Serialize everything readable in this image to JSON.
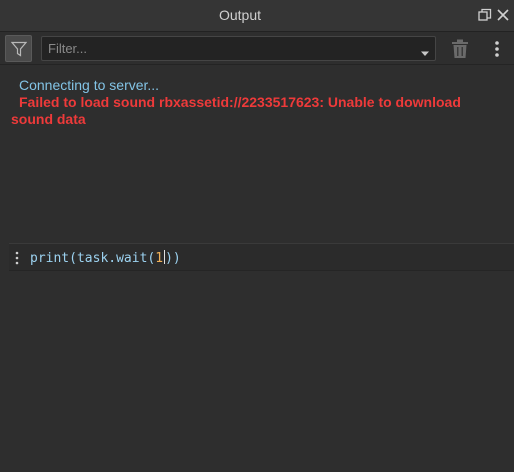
{
  "window": {
    "title": "Output",
    "restore_icon": "restore-window-icon",
    "close_icon": "close-icon"
  },
  "filter": {
    "toggle_icon": "filter-funnel-icon",
    "placeholder": "Filter...",
    "value": "",
    "dropdown_icon": "chevron-down-icon",
    "clear_icon": "trash-icon",
    "menu_icon": "more-vertical-icon"
  },
  "log": {
    "lines": [
      {
        "type": "info",
        "text": "Connecting to server..."
      },
      {
        "type": "error",
        "text": "Failed to load sound rbxassetid://2233517623: Unable to download sound data"
      }
    ],
    "colors": {
      "info": "#83c4e6",
      "error": "#ee3a3a"
    }
  },
  "command": {
    "grip_icon": "drag-grip-icon",
    "code_prefix": "print(task.wait(",
    "code_number": "1",
    "code_suffix": "))"
  }
}
